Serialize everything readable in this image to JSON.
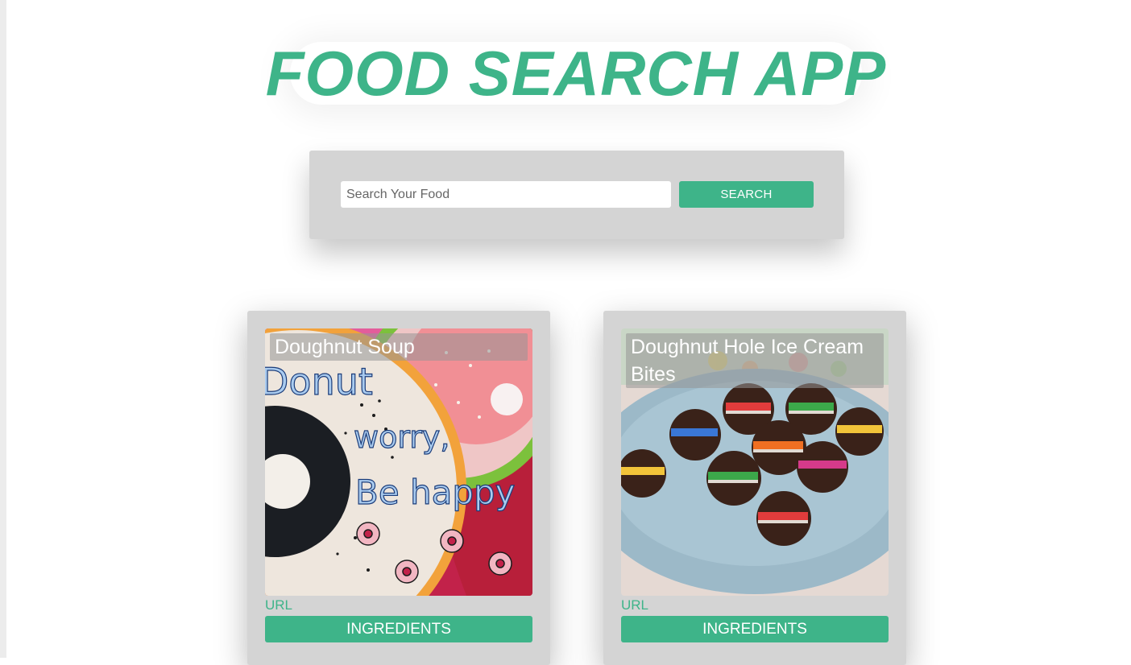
{
  "header": {
    "title": "FOOD SEARCH APP"
  },
  "search": {
    "placeholder": "Search Your Food",
    "value": "",
    "button_label": "SEARCH"
  },
  "results": [
    {
      "title": "Doughnut Soup",
      "image_icon": "donut-worry-be-happy-photo",
      "image_text": [
        "Donut",
        "worry,",
        "Be happy"
      ],
      "url_label": "URL",
      "ingredients_label": "INGREDIENTS"
    },
    {
      "title": "Doughnut Hole Ice Cream Bites",
      "image_icon": "doughnut-hole-ice-cream-bites-photo",
      "url_label": "URL",
      "ingredients_label": "INGREDIENTS"
    }
  ],
  "colors": {
    "accent": "#3eb489",
    "panel": "#d4d4d4",
    "background": "#ffffff"
  }
}
